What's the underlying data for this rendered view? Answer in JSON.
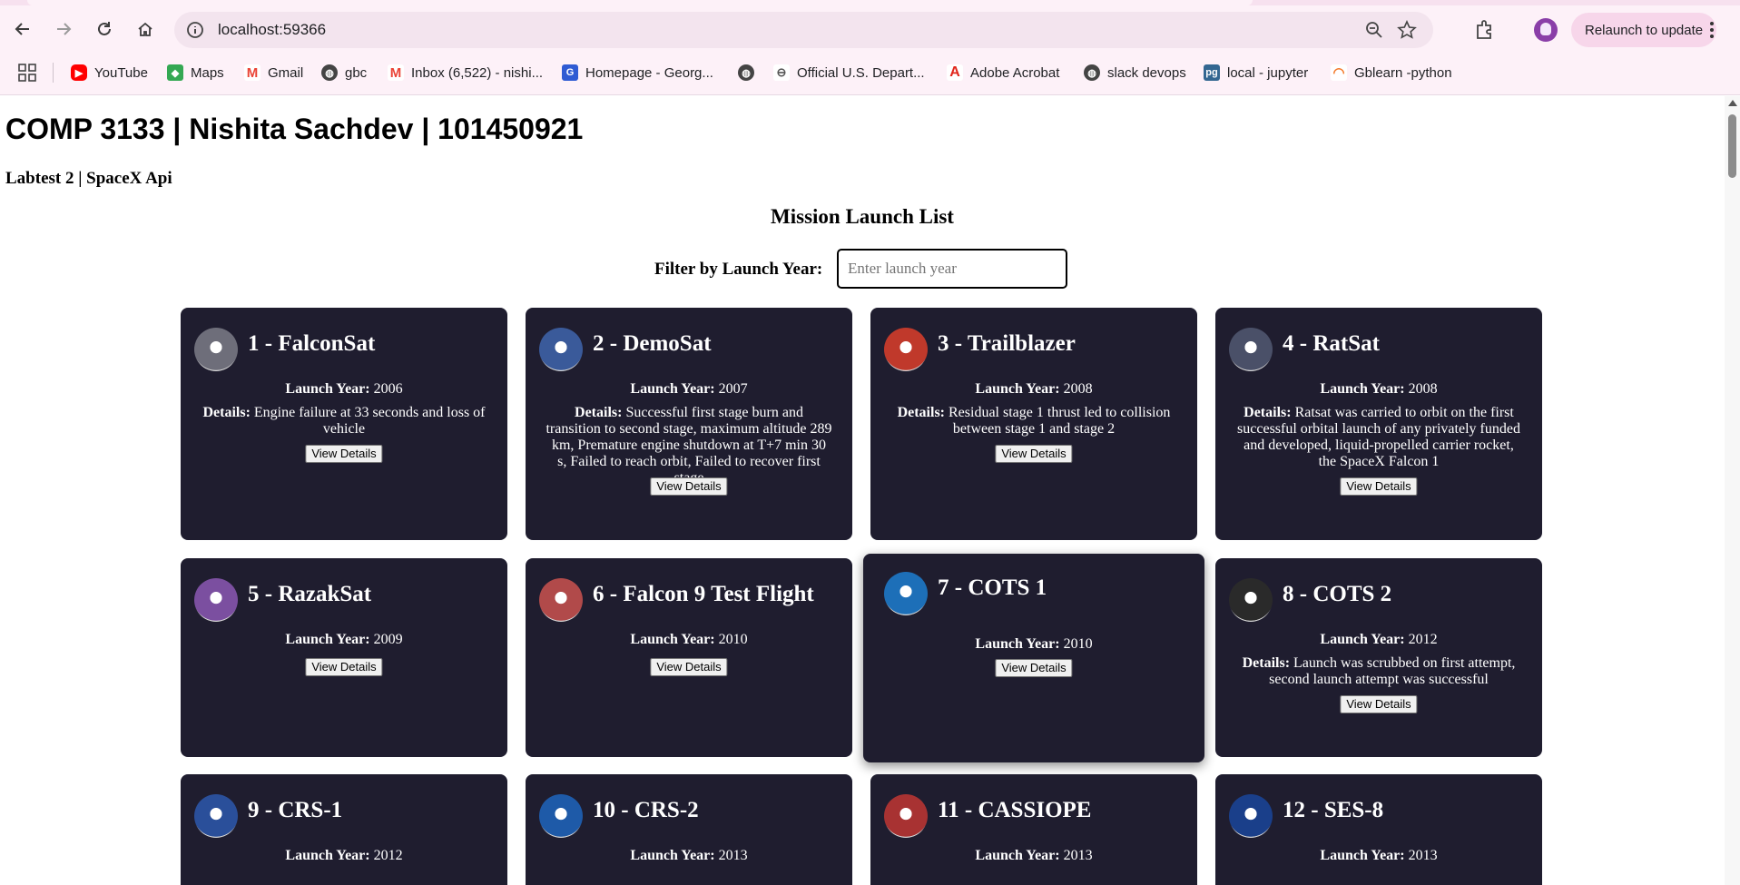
{
  "browser": {
    "url": "localhost:59366",
    "relaunch_label": "Relaunch to update",
    "bookmarks": [
      "YouTube",
      "Maps",
      "Gmail",
      "gbc",
      "Inbox (6,522) - nishi...",
      "Homepage - Georg...",
      "Official U.S. Depart...",
      "Adobe Acrobat",
      "slack devops",
      "local - jupyter",
      "Gblearn -python"
    ]
  },
  "header": {
    "title": "COMP 3133 | Nishita Sachdev | 101450921",
    "subtitle": "Labtest 2 | SpaceX Api"
  },
  "list": {
    "title": "Mission Launch List",
    "filter_label": "Filter by Launch Year:",
    "filter_placeholder": "Enter launch year",
    "filter_value": ""
  },
  "labels": {
    "launch_year": "Launch Year:",
    "details": "Details:",
    "view_details": "View Details"
  },
  "colors": {
    "card_bg": "#1f1d2f",
    "chrome_bg": "#fdf1f8",
    "relaunch_bg": "#f7d6ea"
  },
  "missions": [
    {
      "title": "1 - FalconSat",
      "year": "2006",
      "details": "Engine failure at 33 seconds and loss of vehicle",
      "patch_color": "#6e6e7a"
    },
    {
      "title": "2 - DemoSat",
      "year": "2007",
      "details": "Successful first stage burn and transition to second stage, maximum altitude 289 km, Premature engine shutdown at T+7 min 30 s, Failed to reach orbit, Failed to recover first stage",
      "patch_color": "#3a5a9a"
    },
    {
      "title": "3 - Trailblazer",
      "year": "2008",
      "details": "Residual stage 1 thrust led to collision between stage 1 and stage 2",
      "patch_color": "#c0392b"
    },
    {
      "title": "4 - RatSat",
      "year": "2008",
      "details": "Ratsat was carried to orbit on the first successful orbital launch of any privately funded and developed, liquid-propelled carrier rocket, the SpaceX Falcon 1",
      "patch_color": "#4a5068"
    },
    {
      "title": "5 - RazakSat",
      "year": "2009",
      "details": "",
      "patch_color": "#7b4fa0"
    },
    {
      "title": "6 - Falcon 9 Test Flight",
      "year": "2010",
      "details": "",
      "patch_color": "#b14a4a"
    },
    {
      "title": "7 - COTS 1",
      "year": "2010",
      "details": "",
      "patch_color": "#1d6fb8"
    },
    {
      "title": "8 - COTS 2",
      "year": "2012",
      "details": "Launch was scrubbed on first attempt, second launch attempt was successful",
      "patch_color": "#2a2a2a"
    },
    {
      "title": "9 - CRS-1",
      "year": "2012",
      "details": "",
      "patch_color": "#2a4f9a"
    },
    {
      "title": "10 - CRS-2",
      "year": "2013",
      "details": "",
      "patch_color": "#1e5aa8"
    },
    {
      "title": "11 - CASSIOPE",
      "year": "2013",
      "details": "",
      "patch_color": "#a83232"
    },
    {
      "title": "12 - SES-8",
      "year": "2013",
      "details": "",
      "patch_color": "#1a3f8a"
    }
  ]
}
